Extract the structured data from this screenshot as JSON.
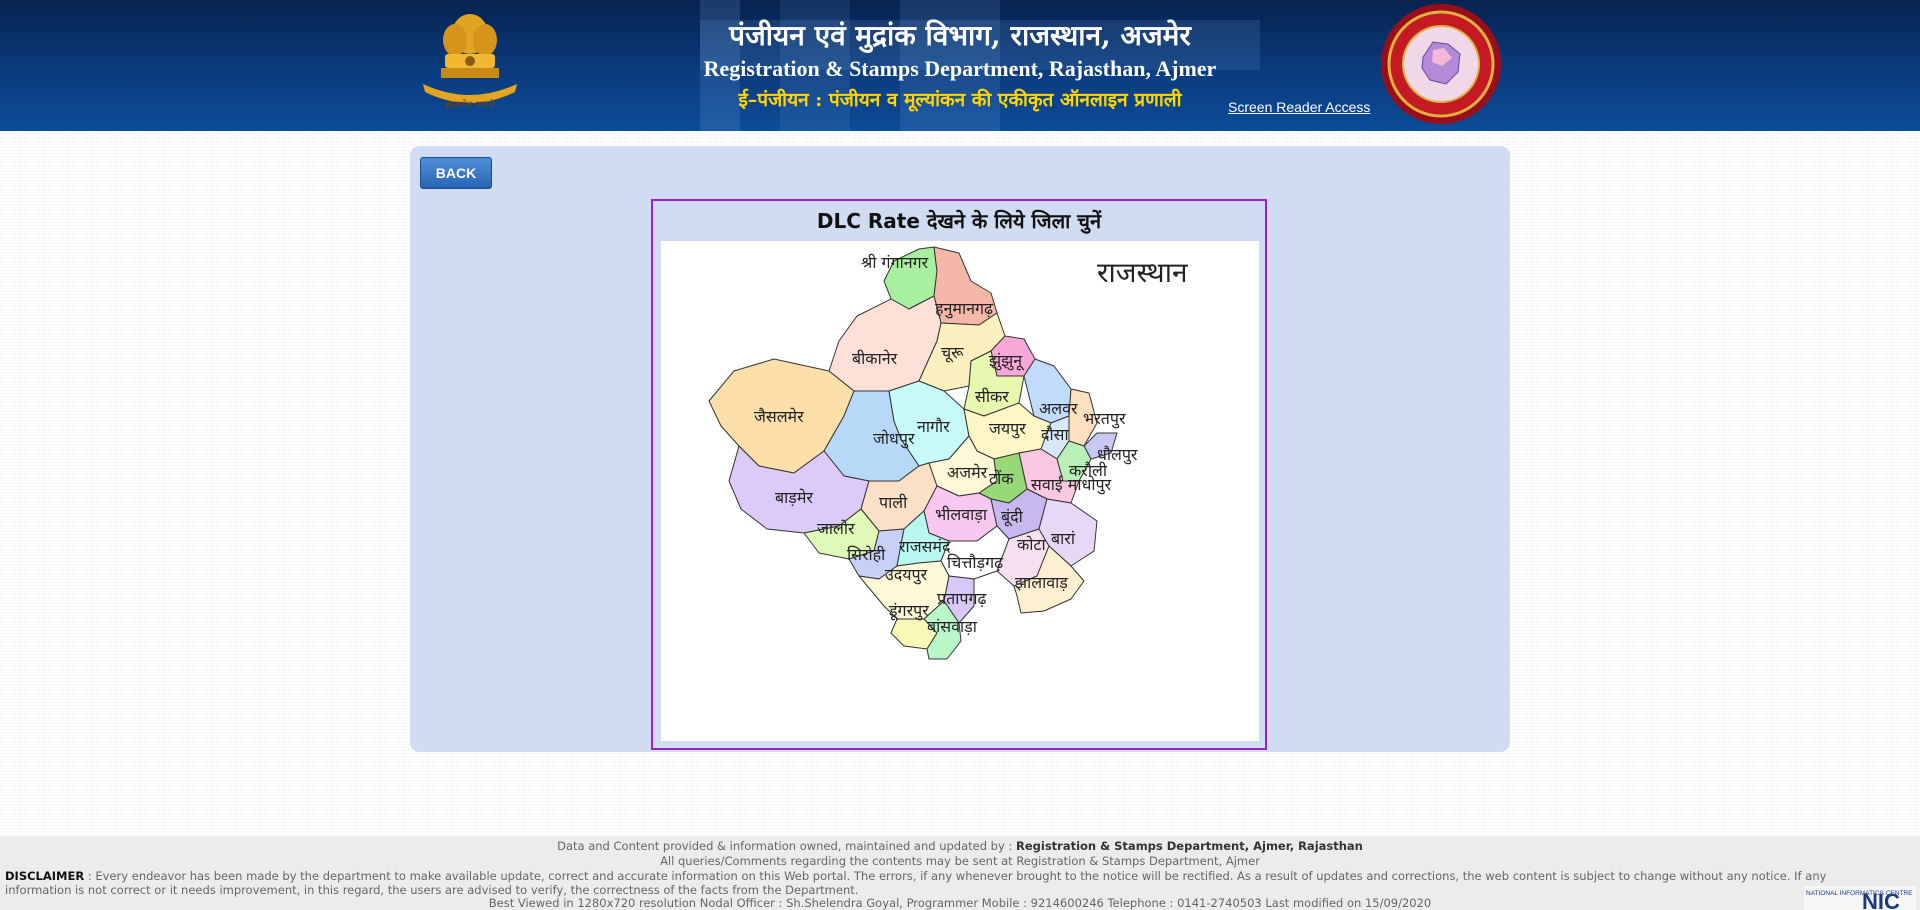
{
  "header": {
    "title_hindi": "पंजीयन एवं मुद्रांक विभाग, राजस्थान, अजमेर",
    "title_english": "Registration & Stamps Department, Rajasthan, Ajmer",
    "subtitle_hindi": "ई–पंजीयन : पंजीयन व मूल्यांकन की एकीकृत ऑनलाइन प्रणाली",
    "screen_reader_link": "Screen Reader Access",
    "emblem_motto": "सत्यमेव जयते"
  },
  "main": {
    "back_button": "BACK",
    "map_title": "DLC Rate देखने के लिये जिला चुनें",
    "state_name": "राजस्थान",
    "districts": [
      {
        "id": "sri-ganganagar",
        "label": "श्री गंगानगर",
        "color": "#a8f0a0"
      },
      {
        "id": "hanumangarh",
        "label": "हनुमानगढ़",
        "color": "#f4b7a8"
      },
      {
        "id": "bikaner",
        "label": "बीकानेर",
        "color": "#fde0d8"
      },
      {
        "id": "churu",
        "label": "चूरू",
        "color": "#fcf0c0"
      },
      {
        "id": "jhunjhunu",
        "label": "झुंझुनू",
        "color": "#f7a8d8"
      },
      {
        "id": "sikar",
        "label": "सीकर",
        "color": "#e8f7b0"
      },
      {
        "id": "alwar",
        "label": "अलवर",
        "color": "#c0dcfa"
      },
      {
        "id": "bharatpur",
        "label": "भरतपुर",
        "color": "#fde0c0"
      },
      {
        "id": "dholpur",
        "label": "धौलपुर",
        "color": "#c8c8f4"
      },
      {
        "id": "jaisalmer",
        "label": "जैसलमेर",
        "color": "#fddfaa"
      },
      {
        "id": "jodhpur",
        "label": "जोधपुर",
        "color": "#b8d8f8"
      },
      {
        "id": "nagaur",
        "label": "नागौर",
        "color": "#c8fafa"
      },
      {
        "id": "jaipur",
        "label": "जयपुर",
        "color": "#fdf7c8"
      },
      {
        "id": "dausa",
        "label": "दौसा",
        "color": "#d8e8f8"
      },
      {
        "id": "karauli",
        "label": "करौली",
        "color": "#b8f0b8"
      },
      {
        "id": "sawai-madhopur",
        "label": "सवाई माधोपुर",
        "color": "#fac8e0"
      },
      {
        "id": "barmer",
        "label": "बाड़मेर",
        "color": "#dccaf8"
      },
      {
        "id": "pali",
        "label": "पाली",
        "color": "#fde0c8"
      },
      {
        "id": "ajmer",
        "label": "अजमेर",
        "color": "#fef8d8"
      },
      {
        "id": "tonk",
        "label": "टोंक",
        "color": "#98d878"
      },
      {
        "id": "jalore",
        "label": "जालोर",
        "color": "#e0f8b8"
      },
      {
        "id": "bhilwara",
        "label": "भीलवाड़ा",
        "color": "#f8c8f0"
      },
      {
        "id": "bundi",
        "label": "बूंदी",
        "color": "#c8b8f0"
      },
      {
        "id": "sirohi",
        "label": "सिरोही",
        "color": "#c8d0f8"
      },
      {
        "id": "rajsamand",
        "label": "राजसमंद",
        "color": "#b8f8f0"
      },
      {
        "id": "chittorgarh",
        "label": "चित्तौड़गढ़",
        "color": "#ffffff"
      },
      {
        "id": "kota",
        "label": "कोटा",
        "color": "#f8e0f0"
      },
      {
        "id": "baran",
        "label": "बारां",
        "color": "#e8d8f8"
      },
      {
        "id": "udaipur",
        "label": "उदयपुर",
        "color": "#fdf8d8"
      },
      {
        "id": "jhalawar",
        "label": "झालावाड़",
        "color": "#fdf0d0"
      },
      {
        "id": "pratapgarh",
        "label": "प्रतापगढ़",
        "color": "#d8c8f8"
      },
      {
        "id": "dungarpur",
        "label": "डूंगरपुर",
        "color": "#f8f8b8"
      },
      {
        "id": "banswara",
        "label": "बांसवाड़ा",
        "color": "#b8f8c8"
      }
    ]
  },
  "footer": {
    "line1_prefix": "Data and Content provided & information owned, maintained and updated by : ",
    "line1_owner": "Registration & Stamps Department, Ajmer, Rajasthan",
    "line2": "All queries/Comments regarding the contents may be sent at Registration & Stamps Department, Ajmer",
    "disclaimer_label": "DISCLAIMER",
    "disclaimer_text": " : Every endeavor has been made by the department to make available update, correct and accurate information on this Web portal. The errors, if any whenever brought to the notice will be rectified. As a result of updates and corrections, the web content is subject to change without any notice. If any information is not correct or it needs improvement, in this regard, the users are advised to verify, the correctness of the facts from the Department.",
    "line4": "Best Viewed in 1280x720 resolution Nodal Officer : Sh.Shelendra Goyal, Programmer Mobile : 9214600246 Telephone : 0141-2740503 Last modified on 15/09/2020",
    "nic_text": "NATIONAL INFORMATICS CENTRE",
    "nic_short": "NIC"
  }
}
